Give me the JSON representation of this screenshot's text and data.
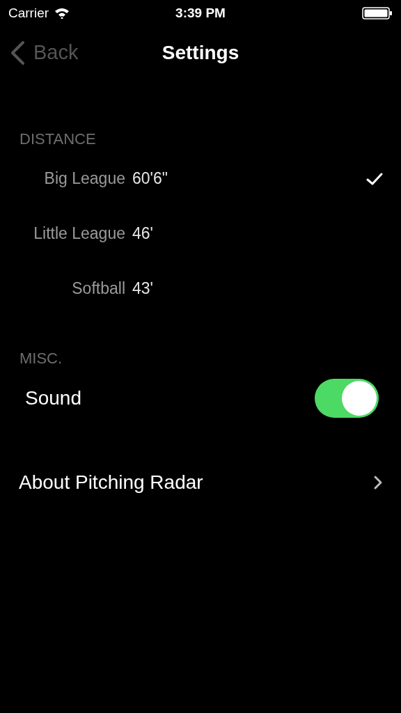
{
  "status_bar": {
    "carrier": "Carrier",
    "time": "3:39 PM"
  },
  "nav": {
    "back": "Back",
    "title": "Settings"
  },
  "sections": [
    {
      "header": "DISTANCE",
      "items": [
        {
          "kind": "distance",
          "label": "Big League",
          "value": "60'6\"",
          "selected": true
        },
        {
          "kind": "distance",
          "label": "Little League",
          "value": "46'",
          "selected": false
        },
        {
          "kind": "distance",
          "label": "Softball",
          "value": "43'",
          "selected": false
        }
      ]
    },
    {
      "header": "MISC.",
      "items": [
        {
          "kind": "toggle",
          "label": "Sound",
          "on": true
        },
        {
          "kind": "link",
          "label": "About Pitching Radar"
        }
      ]
    }
  ]
}
